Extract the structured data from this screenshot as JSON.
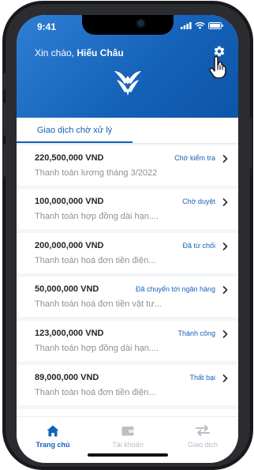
{
  "status_bar": {
    "time": "9:41"
  },
  "header": {
    "greeting_prefix": "Xin chào, ",
    "user_name": "Hiếu Châu",
    "icons": {
      "settings": "gear-icon",
      "cursor": "hand-pointer-icon",
      "logo": "brand-logo"
    }
  },
  "tabs": [
    {
      "label": "Giao dịch chờ xử lý",
      "active": true
    }
  ],
  "transactions": [
    {
      "amount": "220,500,000 VND",
      "description": "Thanh toán lương tháng 3/2022",
      "status": "Chờ kiểm tra"
    },
    {
      "amount": "100,000,000 VND",
      "description": "Thanh toán hợp đồng dài hạn....",
      "status": "Chờ duyệt"
    },
    {
      "amount": "200,000,000 VND",
      "description": "Thanh toán hoá đơn tiền điện...",
      "status": "Đã từ chối"
    },
    {
      "amount": "50,000,000 VND",
      "description": "Thanh toán hoá đơn tiền vật tư...",
      "status": "Đã chuyển tới ngân hàng"
    },
    {
      "amount": "123,000,000 VND",
      "description": "Thanh toán hợp đồng dài hạn....",
      "status": "Thành công"
    },
    {
      "amount": "89,000,000 VND",
      "description": "Thanh toán hoá đơn tiền điện...",
      "status": "Thất bại"
    }
  ],
  "bottom_nav": [
    {
      "label": "Trang chủ",
      "icon": "home-icon",
      "active": true
    },
    {
      "label": "Tài khoản",
      "icon": "wallet-icon",
      "active": false
    },
    {
      "label": "Giao dịch",
      "icon": "transfer-icon",
      "active": false
    }
  ],
  "colors": {
    "primary": "#1462b8",
    "inactive": "#b9bec7"
  }
}
